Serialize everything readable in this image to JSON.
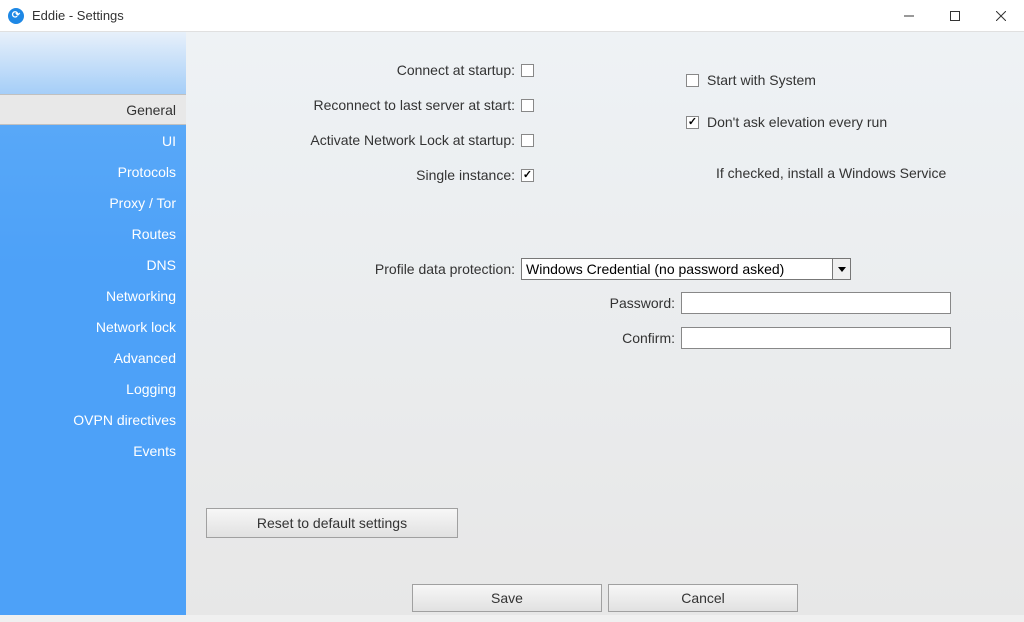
{
  "window": {
    "title": "Eddie - Settings"
  },
  "sidebar": {
    "items": [
      {
        "label": "General",
        "selected": true
      },
      {
        "label": "UI",
        "selected": false
      },
      {
        "label": "Protocols",
        "selected": false
      },
      {
        "label": "Proxy / Tor",
        "selected": false
      },
      {
        "label": "Routes",
        "selected": false
      },
      {
        "label": "DNS",
        "selected": false
      },
      {
        "label": "Networking",
        "selected": false
      },
      {
        "label": "Network lock",
        "selected": false
      },
      {
        "label": "Advanced",
        "selected": false
      },
      {
        "label": "Logging",
        "selected": false
      },
      {
        "label": "OVPN directives",
        "selected": false
      },
      {
        "label": "Events",
        "selected": false
      }
    ]
  },
  "general": {
    "connect_at_startup": {
      "label": "Connect at startup:",
      "checked": false
    },
    "reconnect_last": {
      "label": "Reconnect to last server at start:",
      "checked": false
    },
    "activate_netlock": {
      "label": "Activate Network Lock at startup:",
      "checked": false
    },
    "single_instance": {
      "label": "Single instance:",
      "checked": true
    },
    "start_with_system": {
      "label": "Start with System",
      "checked": false
    },
    "dont_ask_elevation": {
      "label": "Don't ask elevation every run",
      "checked": true
    },
    "service_hint": "If checked, install a Windows Service",
    "profile_protection": {
      "label": "Profile data protection:",
      "selected": "Windows Credential (no password asked)"
    },
    "password": {
      "label": "Password:",
      "value": ""
    },
    "confirm": {
      "label": "Confirm:",
      "value": ""
    }
  },
  "buttons": {
    "reset": "Reset to default settings",
    "save": "Save",
    "cancel": "Cancel"
  }
}
